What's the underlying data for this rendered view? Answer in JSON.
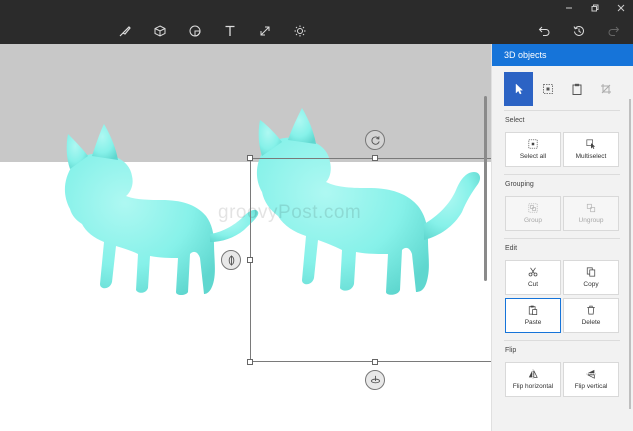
{
  "toolbar": {
    "tools": [
      {
        "name": "brushes-icon"
      },
      {
        "name": "3d-shapes-icon"
      },
      {
        "name": "stickers-icon"
      },
      {
        "name": "text-icon"
      },
      {
        "name": "canvas-icon"
      },
      {
        "name": "effects-icon"
      }
    ],
    "undo_icon": "undo-icon",
    "history_icon": "history-icon",
    "redo_icon": "redo-icon"
  },
  "canvas": {
    "watermark": "groovyPost.com"
  },
  "panel": {
    "title": "3D objects",
    "accent": "#1674d9",
    "sections": {
      "select": {
        "label": "Select",
        "buttons": [
          {
            "label": "Select all",
            "icon": "select-all-icon",
            "enabled": true
          },
          {
            "label": "Multiselect",
            "icon": "multiselect-icon",
            "enabled": true
          }
        ]
      },
      "grouping": {
        "label": "Grouping",
        "buttons": [
          {
            "label": "Group",
            "icon": "group-icon",
            "enabled": false
          },
          {
            "label": "Ungroup",
            "icon": "ungroup-icon",
            "enabled": false
          }
        ]
      },
      "edit": {
        "label": "Edit",
        "buttons": [
          {
            "label": "Cut",
            "icon": "scissors-icon",
            "enabled": true
          },
          {
            "label": "Copy",
            "icon": "copy-icon",
            "enabled": true
          },
          {
            "label": "Paste",
            "icon": "paste-icon",
            "enabled": true,
            "selected": true
          },
          {
            "label": "Delete",
            "icon": "trash-icon",
            "enabled": true
          }
        ]
      },
      "flip": {
        "label": "Flip",
        "buttons": [
          {
            "label": "Flip horizontal",
            "icon": "flip-horizontal-icon",
            "enabled": true
          },
          {
            "label": "Flip vertical",
            "icon": "flip-vertical-icon",
            "enabled": true
          }
        ]
      }
    }
  },
  "colors": {
    "titlebar": "#2b2b2b",
    "canvas_gray": "#c8c8c8",
    "cat": "#86f1e9"
  }
}
